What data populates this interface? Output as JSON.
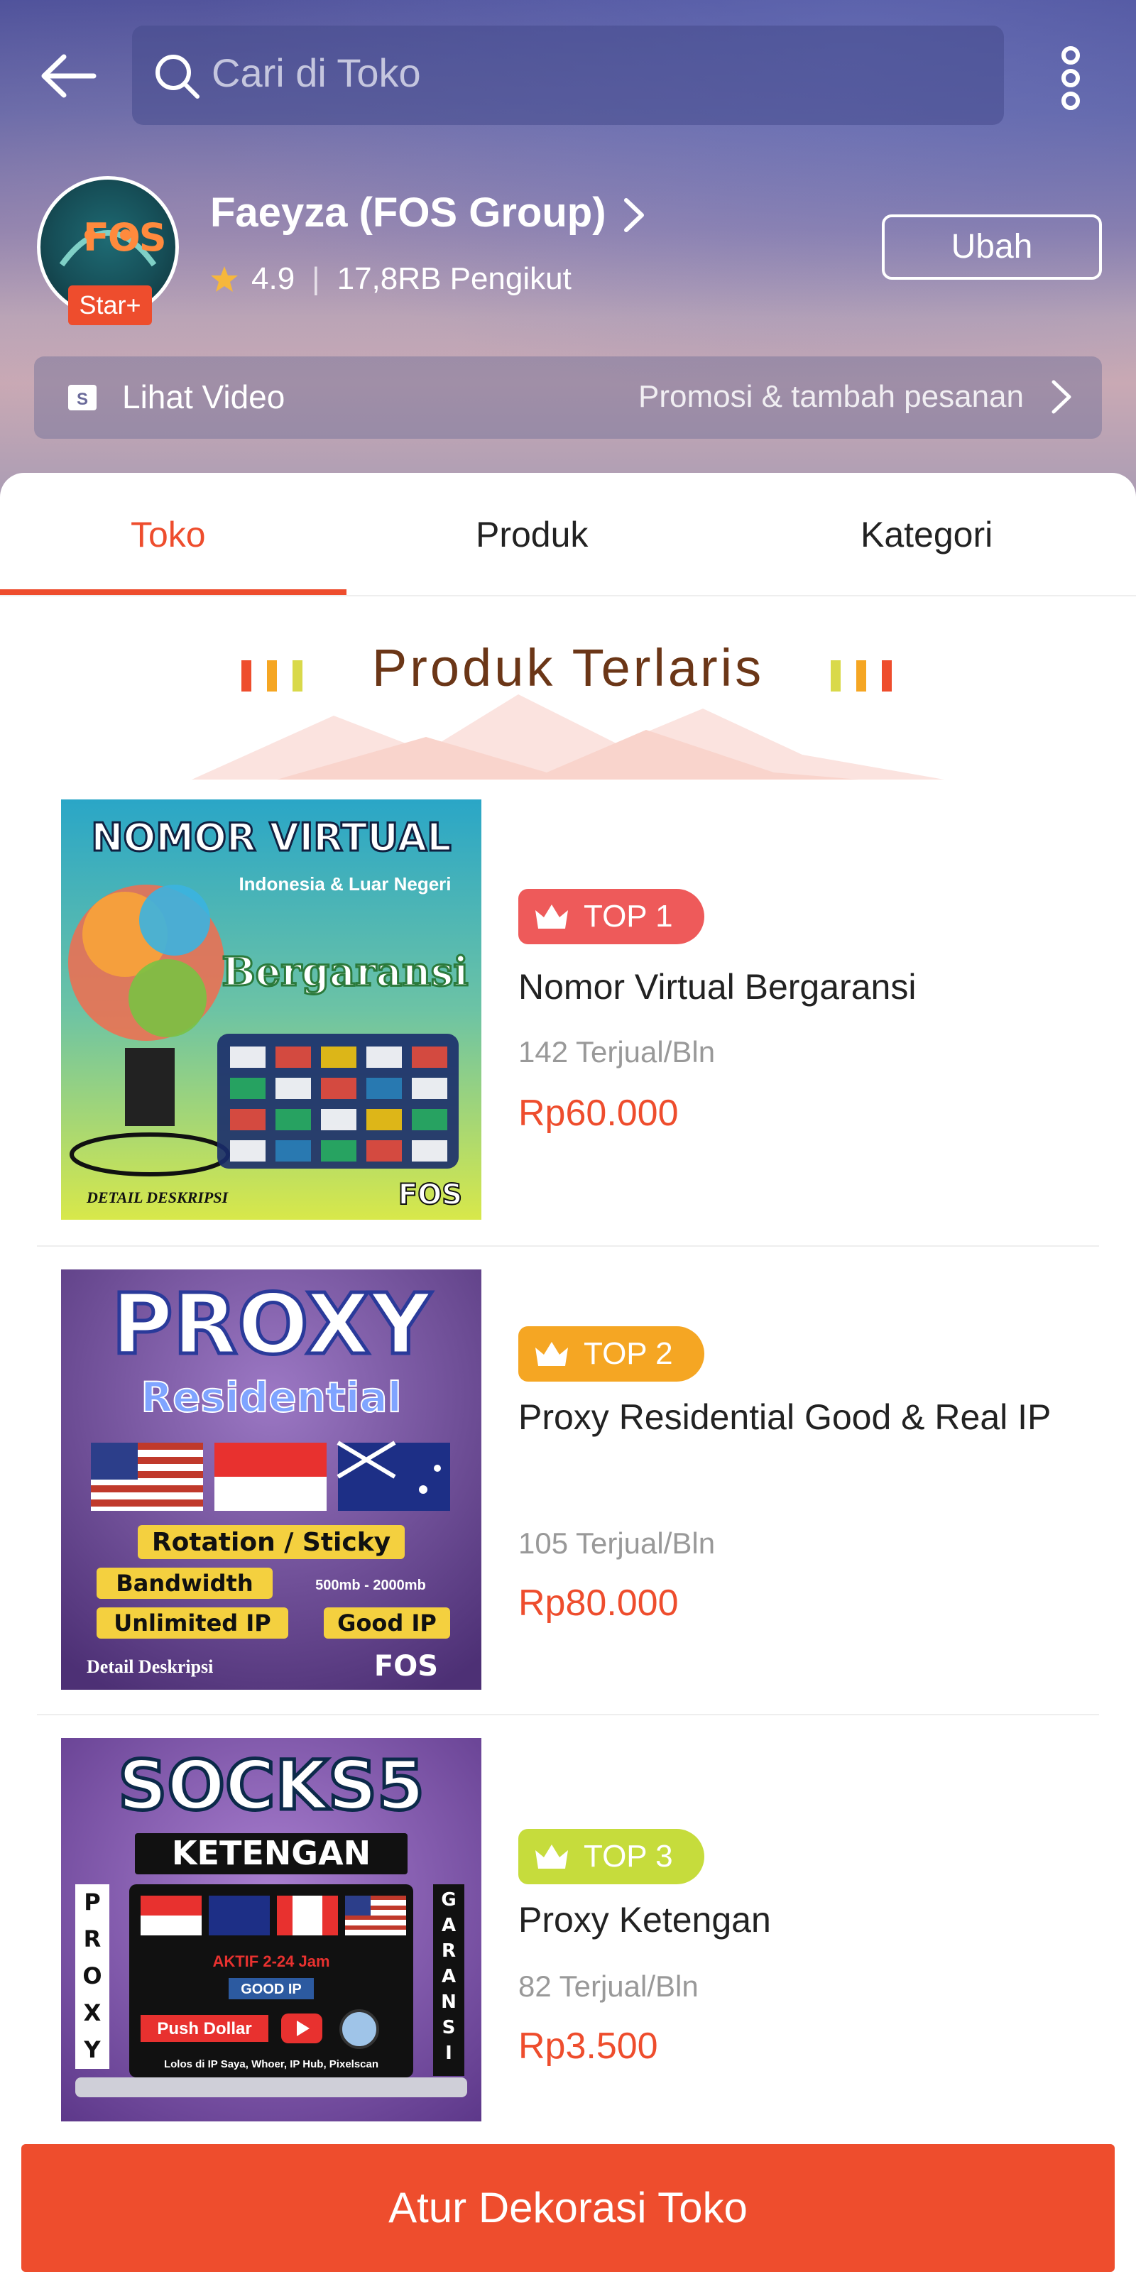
{
  "search": {
    "placeholder": "Cari di Toko"
  },
  "shop": {
    "name": "Faeyza (FOS Group)",
    "badge": "Star+",
    "logo_text": "FOS",
    "rating": "4.9",
    "followers": "17,8RB Pengikut",
    "edit_label": "Ubah"
  },
  "video_bar": {
    "label": "Lihat Video",
    "promo": "Promosi & tambah pesanan"
  },
  "tabs": [
    {
      "label": "Toko",
      "active": true
    },
    {
      "label": "Produk",
      "active": false
    },
    {
      "label": "Kategori",
      "active": false
    }
  ],
  "section": {
    "title": "Produk Terlaris"
  },
  "products": [
    {
      "rank": "TOP 1",
      "rank_color": "#ee5a5a",
      "name": "Nomor Virtual Bergaransi",
      "sold": "142 Terjual/Bln",
      "price": "Rp60.000",
      "image": {
        "title": "NOMOR VIRTUAL",
        "subtitle": "Indonesia & Luar Negeri",
        "tagline": "Bergaransi",
        "footer": "DETAIL DESKRIPSI",
        "brand": "FOS"
      }
    },
    {
      "rank": "TOP 2",
      "rank_color": "#f5a623",
      "name": "Proxy Residential Good & Real IP",
      "sold": "105 Terjual/Bln",
      "price": "Rp80.000",
      "image": {
        "title": "PROXY",
        "subtitle": "Residential",
        "line1": "Rotation / Sticky",
        "line2": "Bandwidth",
        "line2b": "500mb - 2000mb",
        "line3": "Unlimited IP",
        "line3b": "Good IP",
        "footer": "Detail Deskripsi",
        "brand": "FOS"
      }
    },
    {
      "rank": "TOP 3",
      "rank_color": "#c6dc3c",
      "name": "Proxy Ketengan",
      "sold": "82 Terjual/Bln",
      "price": "Rp3.500",
      "image": {
        "title": "SOCKS5",
        "subtitle": "KETENGAN",
        "left_vertical": "PROXY",
        "right_vertical": "GARANSI",
        "line1": "AKTIF 2-24 Jam",
        "line2": "GOOD IP",
        "line3": "Push Dollar",
        "footer": "Lolos di IP Saya, Whoer, IP Hub, Pixelscan"
      }
    }
  ],
  "footer_button": {
    "label": "Atur Dekorasi Toko"
  }
}
